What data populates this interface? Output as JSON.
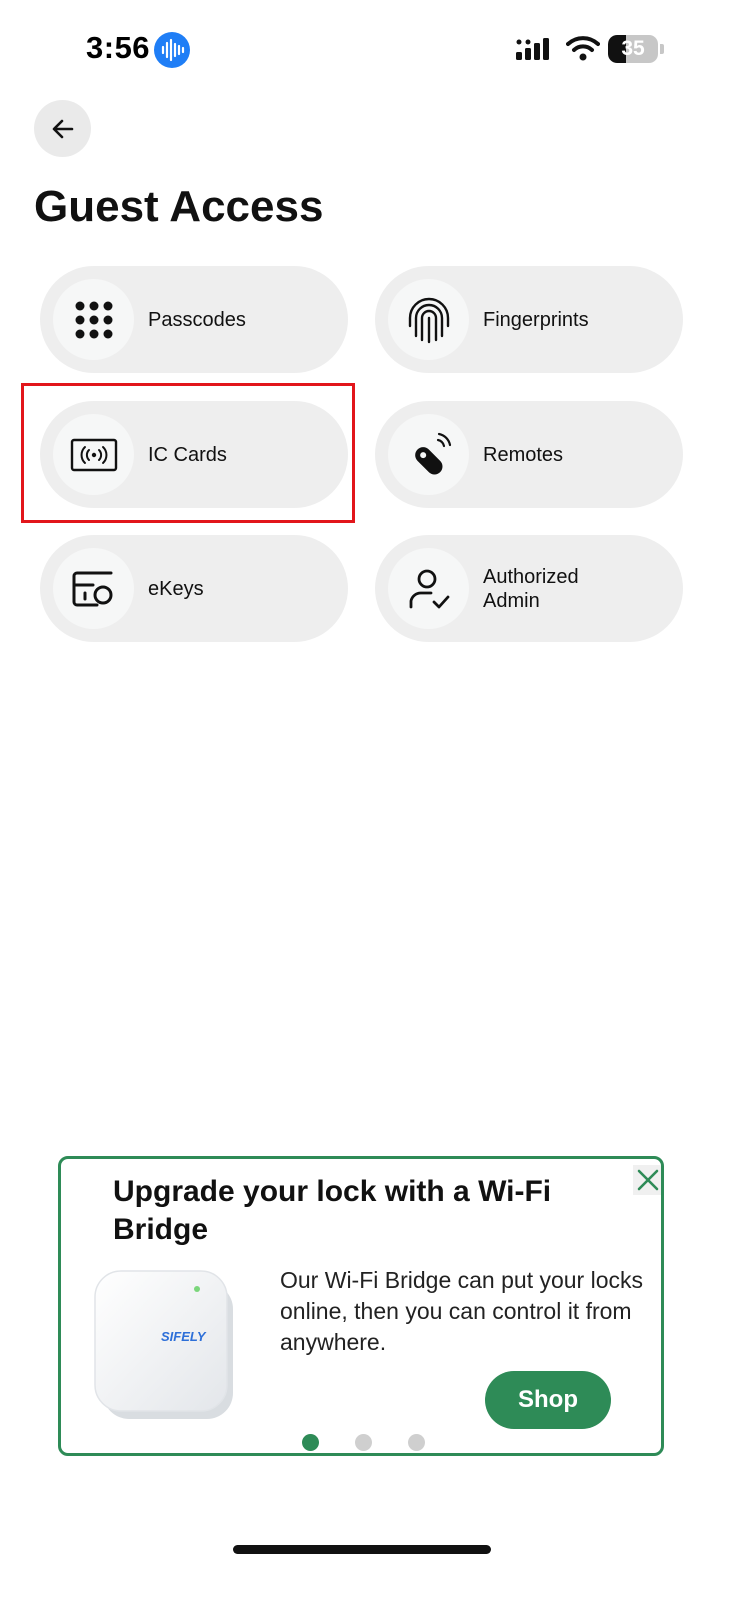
{
  "status_bar": {
    "time": "3:56",
    "battery": "35",
    "battery_level": 0.35,
    "icons": [
      "voice-memo-icon",
      "cellular-signal-icon",
      "wifi-icon",
      "battery-icon"
    ]
  },
  "header": {
    "back_icon": "arrow-left-icon",
    "title": "Guest Access"
  },
  "options": [
    {
      "label": "Passcodes",
      "icon": "keypad-icon"
    },
    {
      "label": "Fingerprints",
      "icon": "fingerprint-icon"
    },
    {
      "label": "IC Cards",
      "icon": "ic-card-icon",
      "highlighted": true
    },
    {
      "label": "Remotes",
      "icon": "remote-fob-icon"
    },
    {
      "label": "eKeys",
      "icon": "ekey-icon"
    },
    {
      "label": "Authorized Admin",
      "icon": "authorized-admin-icon"
    }
  ],
  "promo": {
    "title": "Upgrade your lock with a Wi-Fi Bridge",
    "text": "Our Wi-Fi Bridge can put your locks online, then you can control it from anywhere.",
    "shop_label": "Shop",
    "brand": "SIFELY",
    "close_icon": "close-icon",
    "carousel_active_index": 0,
    "carousel_count": 3
  },
  "colors": {
    "accent_green": "#2e8b57",
    "highlight_red": "#e2161b",
    "card_bg": "#eeeeee",
    "voice_blue": "#1f7ef6"
  }
}
